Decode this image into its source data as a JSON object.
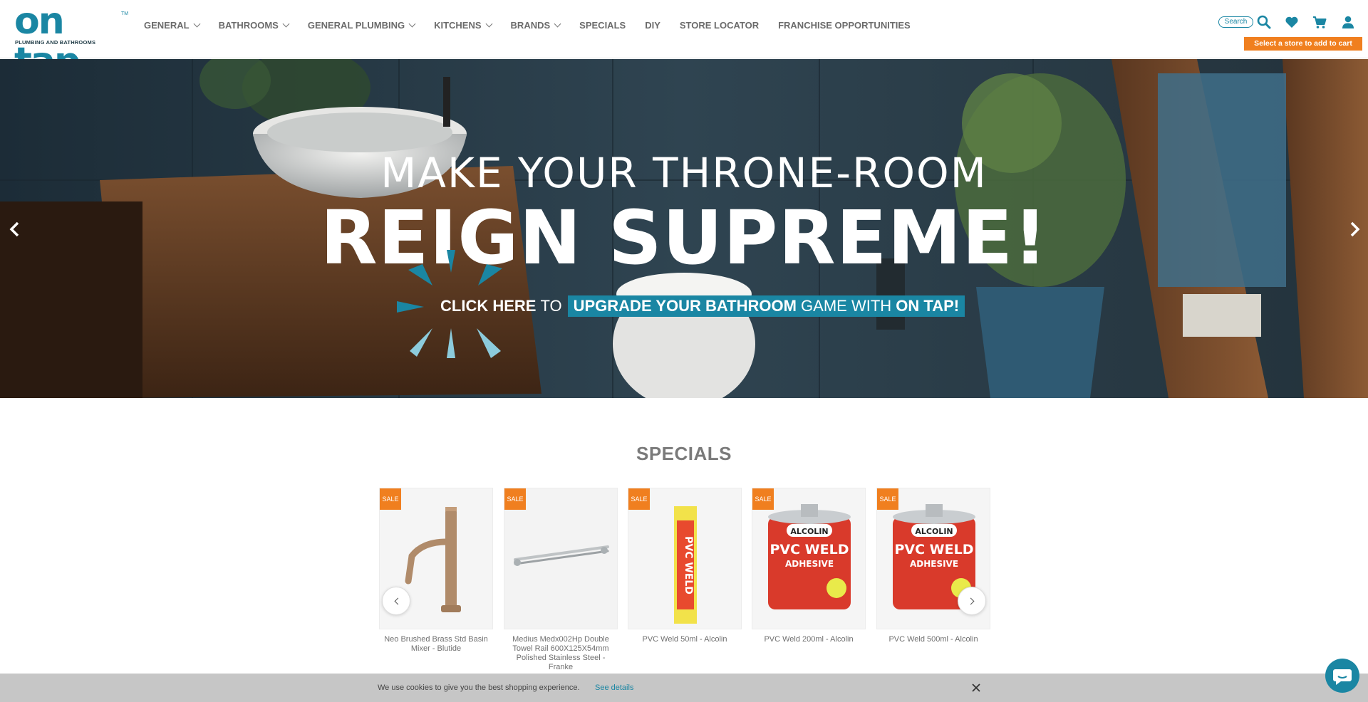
{
  "header": {
    "logo_text": "on tap",
    "logo_tm": "TM",
    "logo_sub": "PLUMBING AND BATHROOMS",
    "nav": [
      {
        "label": "GENERAL",
        "dropdown": true
      },
      {
        "label": "BATHROOMS",
        "dropdown": true
      },
      {
        "label": "GENERAL PLUMBING",
        "dropdown": true
      },
      {
        "label": "KITCHENS",
        "dropdown": true
      },
      {
        "label": "BRANDS",
        "dropdown": true
      },
      {
        "label": "SPECIALS",
        "dropdown": false
      },
      {
        "label": "DIY",
        "dropdown": false
      },
      {
        "label": "STORE LOCATOR",
        "dropdown": false
      },
      {
        "label": "FRANCHISE OPPORTUNITIES",
        "dropdown": false
      }
    ],
    "search_placeholder": "Search",
    "icons": [
      "search-icon",
      "heart-icon",
      "cart-icon",
      "user-icon"
    ],
    "store_button": "Select a store to add to cart"
  },
  "hero": {
    "line1": "MAKE YOUR THRONE-ROOM",
    "line2": "REIGN SUPREME!",
    "cta_click": "CLICK HERE",
    "cta_to": "TO",
    "cta_upgrade": "UPGRADE YOUR BATHROOM",
    "cta_game": "GAME WITH",
    "cta_ontap": "ON TAP!"
  },
  "specials": {
    "title": "SPECIALS",
    "sale_label": "SALE",
    "products": [
      {
        "name": "Neo Brushed Brass Std Basin Mixer - Blutide",
        "image": "brass-basin-mixer"
      },
      {
        "name": "Medius Medx002Hp Double Towel Rail 600X125X54mm Polished Stainless Steel - Franke",
        "image": "towel-rail"
      },
      {
        "name": "PVC Weld 50ml - Alcolin",
        "image": "pvc-weld-tube"
      },
      {
        "name": "PVC Weld 200ml - Alcolin",
        "image": "pvc-weld-tin"
      },
      {
        "name": "PVC Weld 500ml - Alcolin",
        "image": "pvc-weld-tin"
      }
    ]
  },
  "cookie": {
    "message": "We use cookies to give you the best shopping experience.",
    "link": "See details"
  },
  "colors": {
    "brand": "#1a86a3",
    "accent": "#f07f1f"
  }
}
